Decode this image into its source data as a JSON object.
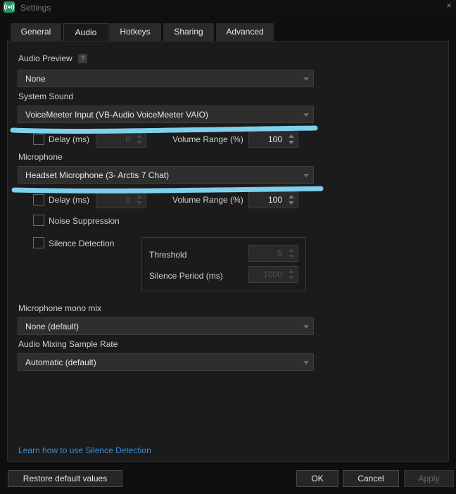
{
  "window": {
    "title": "Settings"
  },
  "tabs": [
    {
      "label": "General"
    },
    {
      "label": "Audio"
    },
    {
      "label": "Hotkeys"
    },
    {
      "label": "Sharing"
    },
    {
      "label": "Advanced"
    }
  ],
  "active_tab": "Audio",
  "audio_preview": {
    "label": "Audio Preview",
    "help": "?",
    "value": "None"
  },
  "system_sound": {
    "label": "System Sound",
    "value": "VoiceMeeter Input (VB-Audio VoiceMeeter VAIO)",
    "delay_label": "Delay (ms)",
    "delay_value": "0",
    "volume_label": "Volume Range (%)",
    "volume_value": "100"
  },
  "microphone": {
    "label": "Microphone",
    "value": "Headset Microphone (3- Arctis 7 Chat)",
    "delay_label": "Delay (ms)",
    "delay_value": "0",
    "volume_label": "Volume Range (%)",
    "volume_value": "100",
    "noise_suppression_label": "Noise Suppression",
    "silence_detection_label": "Silence Detection",
    "threshold_label": "Threshold",
    "threshold_value": "5",
    "silence_period_label": "Silence Period (ms)",
    "silence_period_value": "1000"
  },
  "mono_mix": {
    "label": "Microphone mono mix",
    "value": "None (default)"
  },
  "sample_rate": {
    "label": "Audio Mixing Sample Rate",
    "value": "Automatic (default)"
  },
  "help_link": "Learn how to use Silence Detection",
  "footer": {
    "restore_label": "Restore default values",
    "ok_label": "OK",
    "cancel_label": "Cancel",
    "apply_label": "Apply"
  },
  "colors": {
    "background": "#1b1b1b",
    "link": "#3a8fd9",
    "scribble": "#7ed0ec",
    "app_icon": "#2a8f63"
  }
}
